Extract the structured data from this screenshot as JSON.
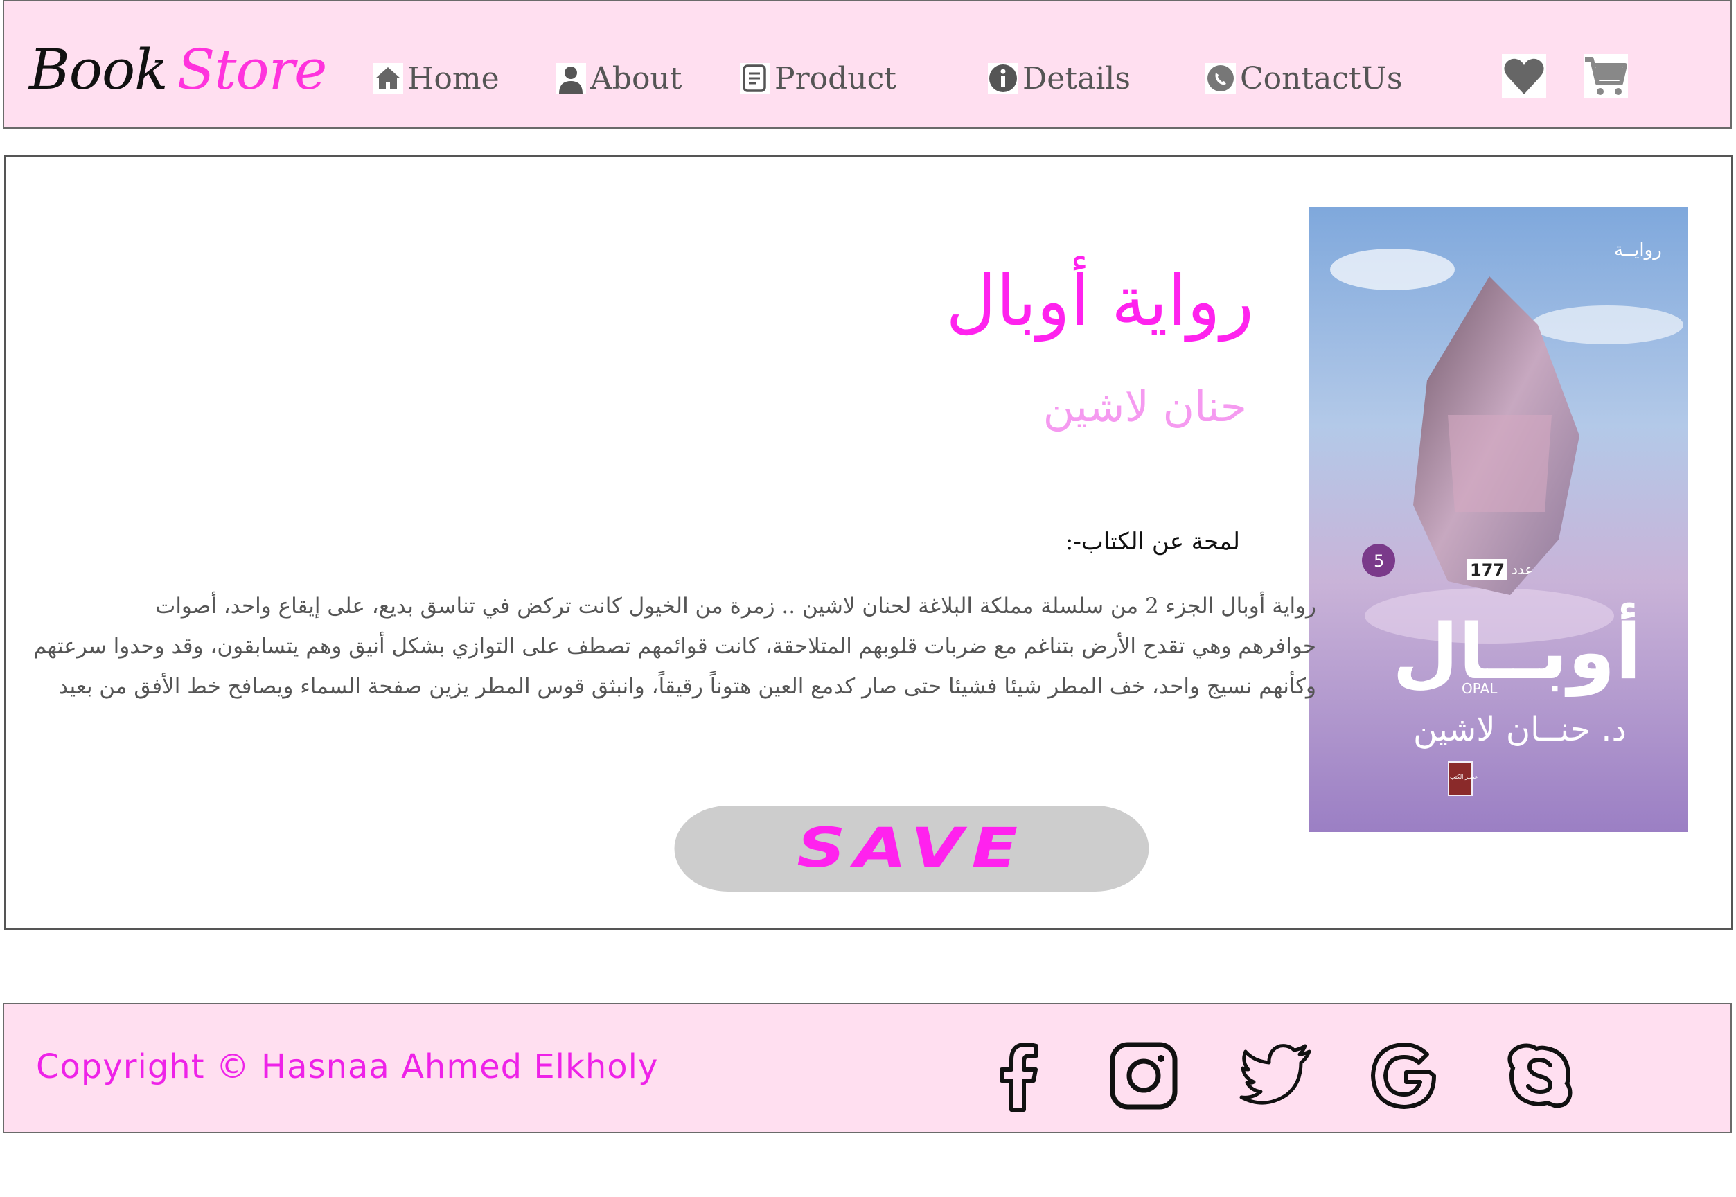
{
  "header": {
    "logo_part1": "Book",
    "logo_part2": "Store",
    "nav": [
      {
        "label": "Home",
        "icon": "home-icon"
      },
      {
        "label": "About",
        "icon": "user-icon"
      },
      {
        "label": "Product",
        "icon": "document-icon"
      },
      {
        "label": "Details",
        "icon": "info-icon"
      },
      {
        "label": "ContactUs",
        "icon": "phone-icon"
      }
    ],
    "actions": [
      "heart-icon",
      "cart-icon"
    ]
  },
  "book": {
    "title": "رواية أوبال",
    "author": "حنان لاشين",
    "about_label": "لمحة عن الكتاب-:",
    "description_lines": [
      "رواية أوبال الجزء 2 من سلسلة مملكة البلاغة لحنان لاشين .. زمرة من الخيول كانت تركض في تناسق بديع، على إيقاع واحد، أصوات",
      "حوافرهم وهي تقدح الأرض بتناغم مع ضربات قلوبهم المتلاحقة، كانت قوائمهم تصطف على التوازي بشكل أنيق وهم يتسابقون، وقد وحدوا سرعتهم",
      "وكأنهم نسيج واحد، خف المطر شيئا فشيئا حتى صار كدمع العين هتوناً رقيقاً، وانبثق قوس المطر يزين صفحة السماء ويصافح خط الأفق من بعيد"
    ],
    "cover": {
      "top_label": "روايــة",
      "number": "177",
      "number_label": "عدد",
      "edition": "5",
      "title": "أوبــال",
      "title_latin": "OPAL",
      "author": "د. حنــان لاشين",
      "publisher": "عصير الكتب"
    },
    "save_label": "SAVE"
  },
  "footer": {
    "copyright": "Copyright © Hasnaa Ahmed Elkholy",
    "social": [
      "facebook-icon",
      "instagram-icon",
      "twitter-icon",
      "google-icon",
      "skype-icon"
    ]
  },
  "colors": {
    "header_bg": "#ffdff0",
    "accent": "#ff22ee",
    "author": "#f59af0",
    "button_bg": "#cdcdcd"
  }
}
